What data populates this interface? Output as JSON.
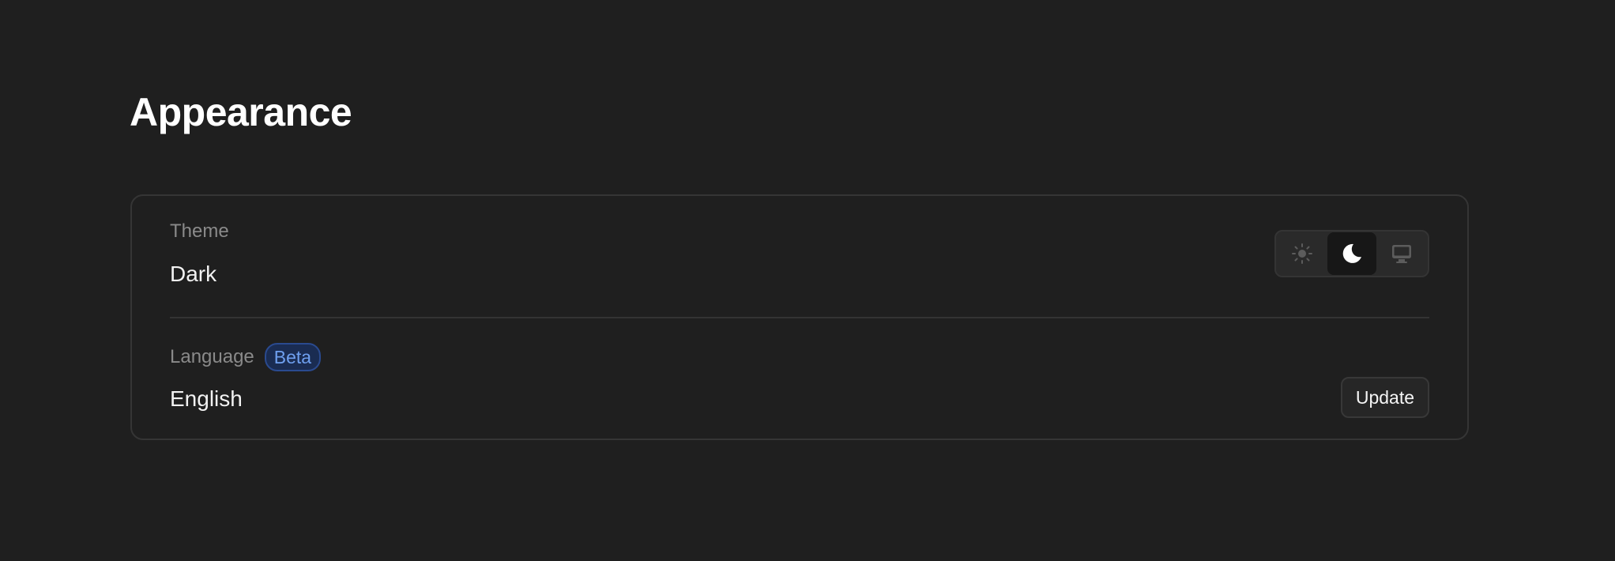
{
  "page": {
    "title": "Appearance"
  },
  "theme": {
    "label": "Theme",
    "value": "Dark",
    "options": [
      {
        "id": "light",
        "icon": "sun-icon",
        "active": false
      },
      {
        "id": "dark",
        "icon": "moon-icon",
        "active": true
      },
      {
        "id": "system",
        "icon": "monitor-icon",
        "active": false
      }
    ]
  },
  "language": {
    "label": "Language",
    "badge": "Beta",
    "value": "English",
    "update_label": "Update"
  },
  "colors": {
    "background": "#1f1f1f",
    "card_border": "#353535",
    "label_text": "#8a8a8a",
    "badge_text": "#6fa0f0",
    "badge_bg": "#1a2c52"
  }
}
